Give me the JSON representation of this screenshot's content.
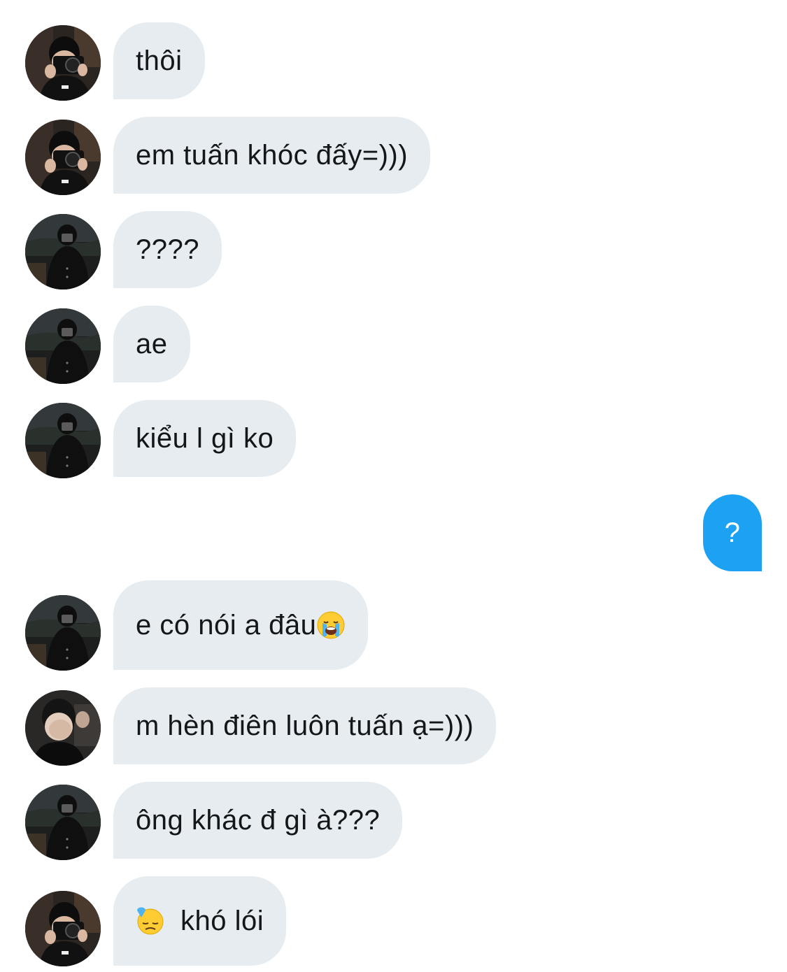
{
  "conversation": {
    "messages": [
      {
        "sender": "avatar-camera",
        "text": "thôi"
      },
      {
        "sender": "avatar-camera",
        "text": "em tuấn khóc đấy=)))"
      },
      {
        "sender": "avatar-mirror",
        "text": "????"
      },
      {
        "sender": "avatar-mirror",
        "text": "ae"
      },
      {
        "sender": "avatar-mirror",
        "text": "kiểu l gì ko"
      },
      {
        "sender": "me",
        "text": "?"
      },
      {
        "sender": "avatar-mirror",
        "text": "e có nói a đâu",
        "emoji": "loudly-crying-face-icon"
      },
      {
        "sender": "avatar-facepalm",
        "text": "m hèn điên luôn tuấn ạ=)))"
      },
      {
        "sender": "avatar-mirror",
        "text": "ông khác đ gì à???"
      },
      {
        "sender": "avatar-camera",
        "text": "khó lói",
        "emoji_before": "downcast-sweat-face-icon"
      }
    ]
  },
  "colors": {
    "incoming_bubble": "#e6ecf0",
    "outgoing_bubble": "#1da1f2",
    "incoming_text": "#14171a",
    "outgoing_text": "#ffffff"
  }
}
